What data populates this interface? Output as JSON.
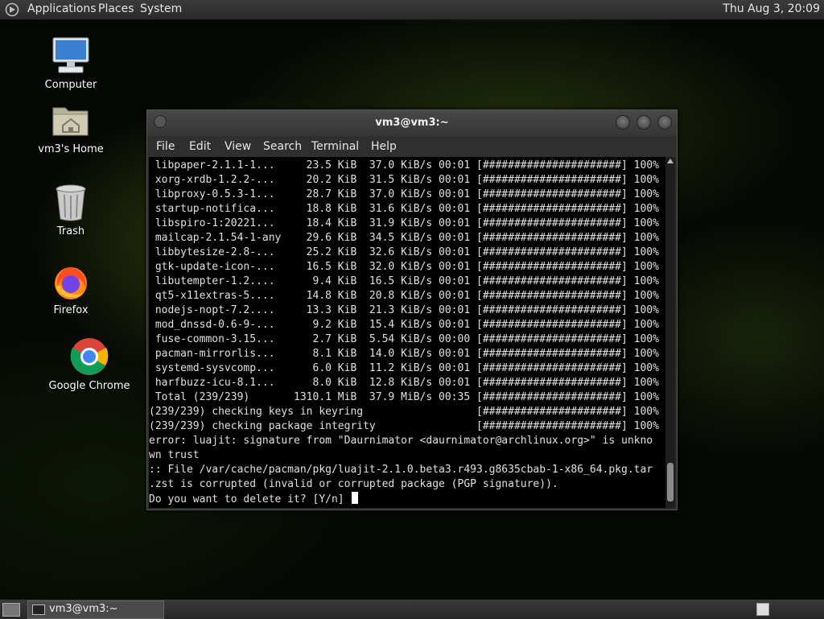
{
  "top_panel": {
    "menus": [
      "Applications",
      "Places",
      "System"
    ],
    "clock": "Thu Aug  3, 20:09"
  },
  "desktop_icons": [
    {
      "label": "Computer",
      "icon": "computer-icon"
    },
    {
      "label": "vm3's Home",
      "icon": "home-folder-icon"
    },
    {
      "label": "Trash",
      "icon": "trash-icon"
    },
    {
      "label": "Firefox",
      "icon": "firefox-icon"
    },
    {
      "label": "Google Chrome",
      "icon": "chrome-icon"
    }
  ],
  "terminal": {
    "title": "vm3@vm3:~",
    "menus": [
      "File",
      "Edit",
      "View",
      "Search",
      "Terminal",
      "Help"
    ],
    "lines": [
      " libpaper-2.1.1-1...     23.5 KiB  37.0 KiB/s 00:01 [######################] 100%",
      " xorg-xrdb-1.2.2-...     20.2 KiB  31.5 KiB/s 00:01 [######################] 100%",
      " libproxy-0.5.3-1...     28.7 KiB  37.0 KiB/s 00:01 [######################] 100%",
      " startup-notifica...     18.8 KiB  31.6 KiB/s 00:01 [######################] 100%",
      " libspiro-1:20221...     18.4 KiB  31.9 KiB/s 00:01 [######################] 100%",
      " mailcap-2.1.54-1-any    29.6 KiB  34.5 KiB/s 00:01 [######################] 100%",
      " libbytesize-2.8-...     25.2 KiB  32.6 KiB/s 00:01 [######################] 100%",
      " gtk-update-icon-...     16.5 KiB  32.0 KiB/s 00:01 [######################] 100%",
      " libutempter-1.2....      9.4 KiB  16.5 KiB/s 00:01 [######################] 100%",
      " qt5-x11extras-5....     14.8 KiB  20.8 KiB/s 00:01 [######################] 100%",
      " nodejs-nopt-7.2....     13.3 KiB  21.3 KiB/s 00:01 [######################] 100%",
      " mod_dnssd-0.6-9-...      9.2 KiB  15.4 KiB/s 00:01 [######################] 100%",
      " fuse-common-3.15...      2.7 KiB  5.54 KiB/s 00:00 [######################] 100%",
      " pacman-mirrorlis...      8.1 KiB  14.0 KiB/s 00:01 [######################] 100%",
      " systemd-sysvcomp...      6.0 KiB  11.2 KiB/s 00:01 [######################] 100%",
      " harfbuzz-icu-8.1...      8.0 KiB  12.8 KiB/s 00:01 [######################] 100%",
      " Total (239/239)       1310.1 MiB  37.9 MiB/s 00:35 [######################] 100%",
      "(239/239) checking keys in keyring                  [######################] 100%",
      "(239/239) checking package integrity                [######################] 100%",
      "error: luajit: signature from \"Daurnimator <daurnimator@archlinux.org>\" is unkno",
      "wn trust",
      ":: File /var/cache/pacman/pkg/luajit-2.1.0.beta3.r493.g8635cbab-1-x86_64.pkg.tar",
      ".zst is corrupted (invalid or corrupted package (PGP signature)).",
      "Do you want to delete it? [Y/n] "
    ]
  },
  "taskbar": {
    "window_button": "vm3@vm3:~"
  }
}
